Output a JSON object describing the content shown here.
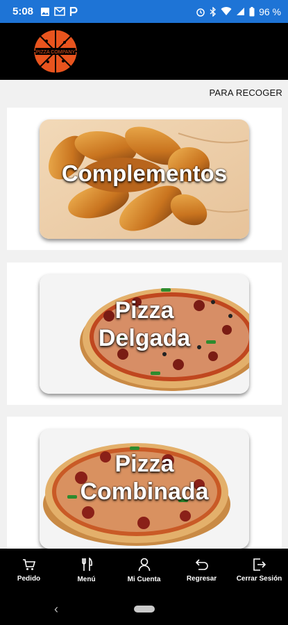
{
  "status_bar": {
    "time": "5:08",
    "battery": "96 %",
    "left_icons": [
      "image-icon",
      "gmail-icon",
      "p-icon"
    ],
    "right_icons": [
      "alarm-icon",
      "bluetooth-icon",
      "wifi-icon",
      "signal-icon",
      "battery-icon"
    ],
    "color": "#1e74d6"
  },
  "header": {
    "logo_text": "PIZZA COMPANY",
    "logo_color": "#e8541e"
  },
  "pickup_label": "PARA RECOGER",
  "categories": [
    {
      "label": "Complementos",
      "image": "potato-wedges-image"
    },
    {
      "label_line1": "Pizza",
      "label_line2": "Delgada",
      "image": "thin-pizza-image"
    },
    {
      "label_line1": "Pizza",
      "label_line2": "Combinada",
      "image": "combo-pizza-image"
    }
  ],
  "bottom_nav": [
    {
      "label": "Pedido",
      "icon": "cart-icon"
    },
    {
      "label": "Menú",
      "icon": "cutlery-icon"
    },
    {
      "label": "Mi Cuenta",
      "icon": "user-icon"
    },
    {
      "label": "Regresar",
      "icon": "undo-icon"
    },
    {
      "label": "Cerrar Sesión",
      "icon": "logout-icon"
    }
  ]
}
